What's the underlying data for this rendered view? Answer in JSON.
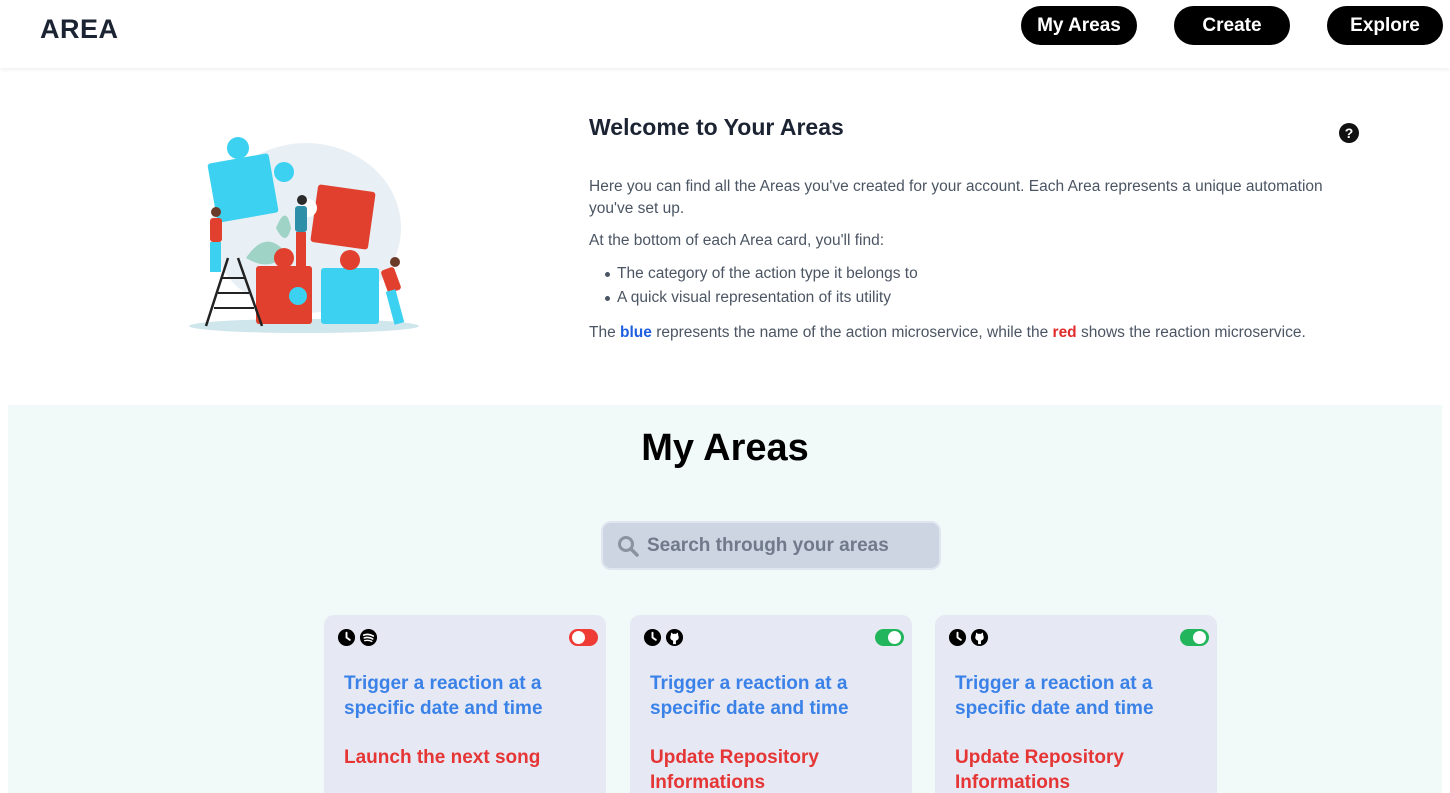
{
  "header": {
    "logo": "AREA",
    "nav": [
      {
        "label": "My Areas"
      },
      {
        "label": "Create"
      },
      {
        "label": "Explore"
      }
    ]
  },
  "welcome": {
    "title": "Welcome to Your Areas",
    "help_icon": "question-circle-icon",
    "paragraph1": "Here you can find all the Areas you've created for your account. Each Area represents a unique automation you've set up.",
    "paragraph2": "At the bottom of each Area card, you'll find:",
    "bullets": [
      "The category of the action type it belongs to",
      "A quick visual representation of its utility"
    ],
    "legend": {
      "prefix": "The",
      "blue_word": "blue",
      "middle": "represents the name of the action microservice, while the",
      "red_word": "red",
      "suffix": "shows the reaction microservice."
    }
  },
  "areas": {
    "title": "My Areas",
    "search": {
      "placeholder": "Search through your areas",
      "value": ""
    },
    "cards": [
      {
        "icons": [
          "clock-icon",
          "spotify-icon"
        ],
        "enabled": false,
        "action": "Trigger a reaction at a specific date and time",
        "reaction": "Launch the next song"
      },
      {
        "icons": [
          "clock-icon",
          "github-icon"
        ],
        "enabled": true,
        "action": "Trigger a reaction at a specific date and time",
        "reaction": "Update Repository Informations"
      },
      {
        "icons": [
          "clock-icon",
          "github-icon"
        ],
        "enabled": true,
        "action": "Trigger a reaction at a specific date and time",
        "reaction": "Update Repository Informations"
      }
    ]
  },
  "colors": {
    "action": "#3b82e8",
    "reaction": "#e53535",
    "toggle_on": "#22b55b",
    "toggle_off": "#ef3b36",
    "section_bg": "#f1faf8",
    "card_bg": "#e6e9f4"
  }
}
